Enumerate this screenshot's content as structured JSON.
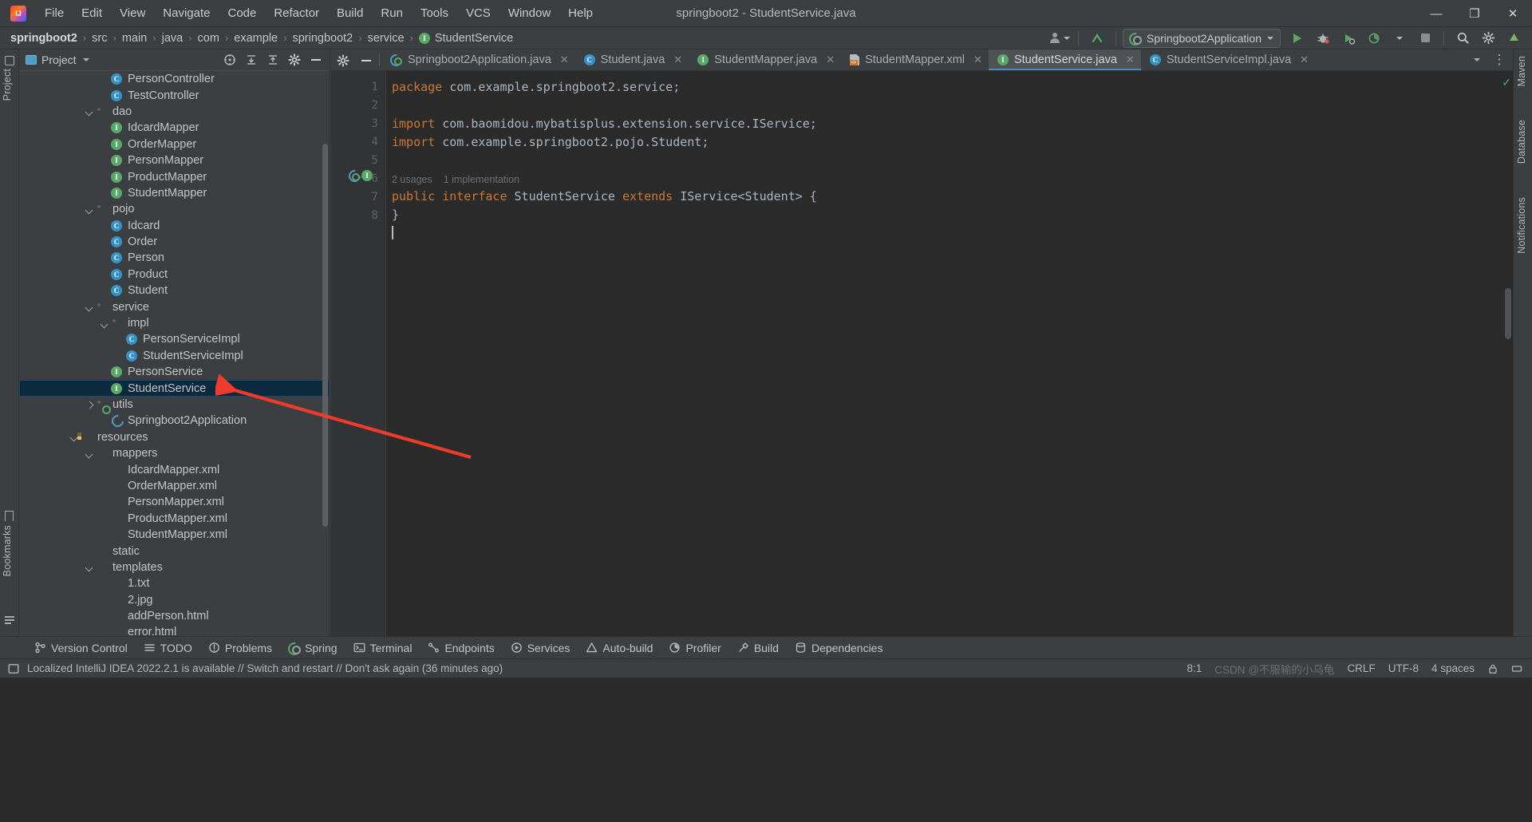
{
  "window": {
    "title": "springboot2 - StudentService.java",
    "logo_alt": "intellij-idea-logo",
    "controls": {
      "minimize": "—",
      "maximize": "❐",
      "close": "✕"
    }
  },
  "menubar": {
    "items": [
      "File",
      "Edit",
      "View",
      "Navigate",
      "Code",
      "Refactor",
      "Build",
      "Run",
      "Tools",
      "VCS",
      "Window",
      "Help"
    ]
  },
  "breadcrumb": {
    "items": [
      "springboot2",
      "src",
      "main",
      "java",
      "com",
      "example",
      "springboot2",
      "service"
    ],
    "separator": "›",
    "leaf": {
      "label": "StudentService",
      "icon_letter": "I"
    }
  },
  "nav_right": {
    "run_config": "Springboot2Application",
    "buttons": [
      "run-button",
      "debug-button",
      "run-with-coverage-button",
      "profiler-button",
      "stop-button",
      "search-everywhere-button",
      "settings-button",
      "updates-button"
    ]
  },
  "project_panel": {
    "title": "Project",
    "header_buttons": [
      "select-opened-file-icon",
      "expand-all-icon",
      "collapse-all-icon",
      "settings-gear-icon",
      "hide-icon"
    ],
    "tree": [
      {
        "label": "PersonController",
        "indent": 5,
        "icon": "class",
        "arrow": "none"
      },
      {
        "label": "TestController",
        "indent": 5,
        "icon": "class",
        "arrow": "none"
      },
      {
        "label": "dao",
        "indent": 4,
        "icon": "folder",
        "arrow": "down"
      },
      {
        "label": "IdcardMapper",
        "indent": 5,
        "icon": "iface",
        "arrow": "none"
      },
      {
        "label": "OrderMapper",
        "indent": 5,
        "icon": "iface",
        "arrow": "none"
      },
      {
        "label": "PersonMapper",
        "indent": 5,
        "icon": "iface",
        "arrow": "none"
      },
      {
        "label": "ProductMapper",
        "indent": 5,
        "icon": "iface",
        "arrow": "none"
      },
      {
        "label": "StudentMapper",
        "indent": 5,
        "icon": "iface",
        "arrow": "none"
      },
      {
        "label": "pojo",
        "indent": 4,
        "icon": "folder",
        "arrow": "down"
      },
      {
        "label": "Idcard",
        "indent": 5,
        "icon": "class",
        "arrow": "none"
      },
      {
        "label": "Order",
        "indent": 5,
        "icon": "class",
        "arrow": "none"
      },
      {
        "label": "Person",
        "indent": 5,
        "icon": "class",
        "arrow": "none"
      },
      {
        "label": "Product",
        "indent": 5,
        "icon": "class",
        "arrow": "none"
      },
      {
        "label": "Student",
        "indent": 5,
        "icon": "class",
        "arrow": "none"
      },
      {
        "label": "service",
        "indent": 4,
        "icon": "folder",
        "arrow": "down"
      },
      {
        "label": "impl",
        "indent": 5,
        "icon": "folder",
        "arrow": "down"
      },
      {
        "label": "PersonServiceImpl",
        "indent": 6,
        "icon": "class",
        "arrow": "none"
      },
      {
        "label": "StudentServiceImpl",
        "indent": 6,
        "icon": "class",
        "arrow": "none"
      },
      {
        "label": "PersonService",
        "indent": 5,
        "icon": "iface",
        "arrow": "none"
      },
      {
        "label": "StudentService",
        "indent": 5,
        "icon": "iface",
        "arrow": "none",
        "selected": true
      },
      {
        "label": "utils",
        "indent": 4,
        "icon": "folder",
        "arrow": "right"
      },
      {
        "label": "Springboot2Application",
        "indent": 5,
        "icon": "spring",
        "arrow": "none"
      },
      {
        "label": "resources",
        "indent": 3,
        "icon": "resfolder",
        "arrow": "down"
      },
      {
        "label": "mappers",
        "indent": 4,
        "icon": "plainfolder",
        "arrow": "down"
      },
      {
        "label": "IdcardMapper.xml",
        "indent": 5,
        "icon": "xml",
        "arrow": "none"
      },
      {
        "label": "OrderMapper.xml",
        "indent": 5,
        "icon": "xml",
        "arrow": "none"
      },
      {
        "label": "PersonMapper.xml",
        "indent": 5,
        "icon": "xml",
        "arrow": "none"
      },
      {
        "label": "ProductMapper.xml",
        "indent": 5,
        "icon": "xml",
        "arrow": "none"
      },
      {
        "label": "StudentMapper.xml",
        "indent": 5,
        "icon": "xml",
        "arrow": "none"
      },
      {
        "label": "static",
        "indent": 4,
        "icon": "plainfolder",
        "arrow": "none"
      },
      {
        "label": "templates",
        "indent": 4,
        "icon": "plainfolder",
        "arrow": "down"
      },
      {
        "label": "1.txt",
        "indent": 5,
        "icon": "txt",
        "arrow": "none"
      },
      {
        "label": "2.jpg",
        "indent": 5,
        "icon": "img",
        "arrow": "none"
      },
      {
        "label": "addPerson.html",
        "indent": 5,
        "icon": "html",
        "arrow": "none"
      },
      {
        "label": "error.html",
        "indent": 5,
        "icon": "html",
        "arrow": "none"
      }
    ]
  },
  "editor": {
    "tabs": [
      {
        "label": "Springboot2Application.java",
        "icon": "spring",
        "active": false
      },
      {
        "label": "Student.java",
        "icon": "class",
        "active": false
      },
      {
        "label": "StudentMapper.java",
        "icon": "iface",
        "active": false
      },
      {
        "label": "StudentMapper.xml",
        "icon": "xml",
        "active": false
      },
      {
        "label": "StudentService.java",
        "icon": "iface",
        "active": true
      },
      {
        "label": "StudentServiceImpl.java",
        "icon": "class",
        "active": false
      }
    ],
    "tab_overflow_icon": "chevron-down-icon",
    "tab_options_icon": "more-options-icon",
    "line_numbers": [
      "1",
      "2",
      "3",
      "4",
      "5",
      "6",
      "7",
      "8"
    ],
    "lines": [
      {
        "n": 1,
        "tokens": [
          {
            "t": "package ",
            "c": "kw"
          },
          {
            "t": "com.example.springboot2.service;",
            "c": "pl"
          }
        ]
      },
      {
        "n": 2,
        "tokens": []
      },
      {
        "n": 3,
        "tokens": [
          {
            "t": "import ",
            "c": "kw"
          },
          {
            "t": "com.baomidou.mybatisplus.extension.service.IService;",
            "c": "pl"
          }
        ]
      },
      {
        "n": 4,
        "tokens": [
          {
            "t": "import ",
            "c": "kw"
          },
          {
            "t": "com.example.springboot2.pojo.Student;",
            "c": "pl"
          }
        ]
      },
      {
        "n": 5,
        "tokens": []
      },
      {
        "n": 6,
        "tokens": [
          {
            "t": "public ",
            "c": "kw"
          },
          {
            "t": "interface ",
            "c": "kw"
          },
          {
            "t": "StudentService ",
            "c": "pl"
          },
          {
            "t": "extends ",
            "c": "kw"
          },
          {
            "t": "IService<Student> {",
            "c": "pl"
          }
        ]
      },
      {
        "n": 7,
        "tokens": [
          {
            "t": "}",
            "c": "pl"
          }
        ]
      },
      {
        "n": 8,
        "tokens": []
      }
    ],
    "inlay_hints": {
      "usages": "2 usages",
      "implementations": "1 implementation"
    },
    "inspection_status": "✓"
  },
  "right_rail": {
    "items": [
      "Maven",
      "Database",
      "Notifications"
    ]
  },
  "left_rail": {
    "items": [
      "Project",
      "Bookmarks",
      "Structure"
    ]
  },
  "bottom_toolbar": {
    "items": [
      {
        "label": "Version Control",
        "icon": "branch-icon"
      },
      {
        "label": "TODO",
        "icon": "list-icon"
      },
      {
        "label": "Problems",
        "icon": "warning-icon"
      },
      {
        "label": "Spring",
        "icon": "spring-icon"
      },
      {
        "label": "Terminal",
        "icon": "terminal-icon"
      },
      {
        "label": "Endpoints",
        "icon": "endpoints-icon"
      },
      {
        "label": "Services",
        "icon": "services-icon"
      },
      {
        "label": "Auto-build",
        "icon": "autobuild-icon"
      },
      {
        "label": "Profiler",
        "icon": "profiler-icon"
      },
      {
        "label": "Build",
        "icon": "hammer-icon"
      },
      {
        "label": "Dependencies",
        "icon": "dependencies-icon"
      }
    ]
  },
  "statusbar": {
    "message": "Localized IntelliJ IDEA 2022.2.1 is available // Switch and restart // Don't ask again (36 minutes ago)",
    "caret_position": "8:1",
    "line_separator": "CRLF",
    "encoding": "UTF-8",
    "indent": "4 spaces",
    "watermark": "CSDN @不服输的小乌龟"
  },
  "annotation": {
    "arrow_color": "#ef3b2d",
    "points_to": "StudentService"
  },
  "colors": {
    "background": "#3c3f41",
    "editor_background": "#2b2b2b",
    "selection": "#0d293e",
    "accent_blue": "#3592c4",
    "accent_green": "#59a869",
    "keyword_orange": "#cc7832",
    "text": "#bbbbbb"
  }
}
